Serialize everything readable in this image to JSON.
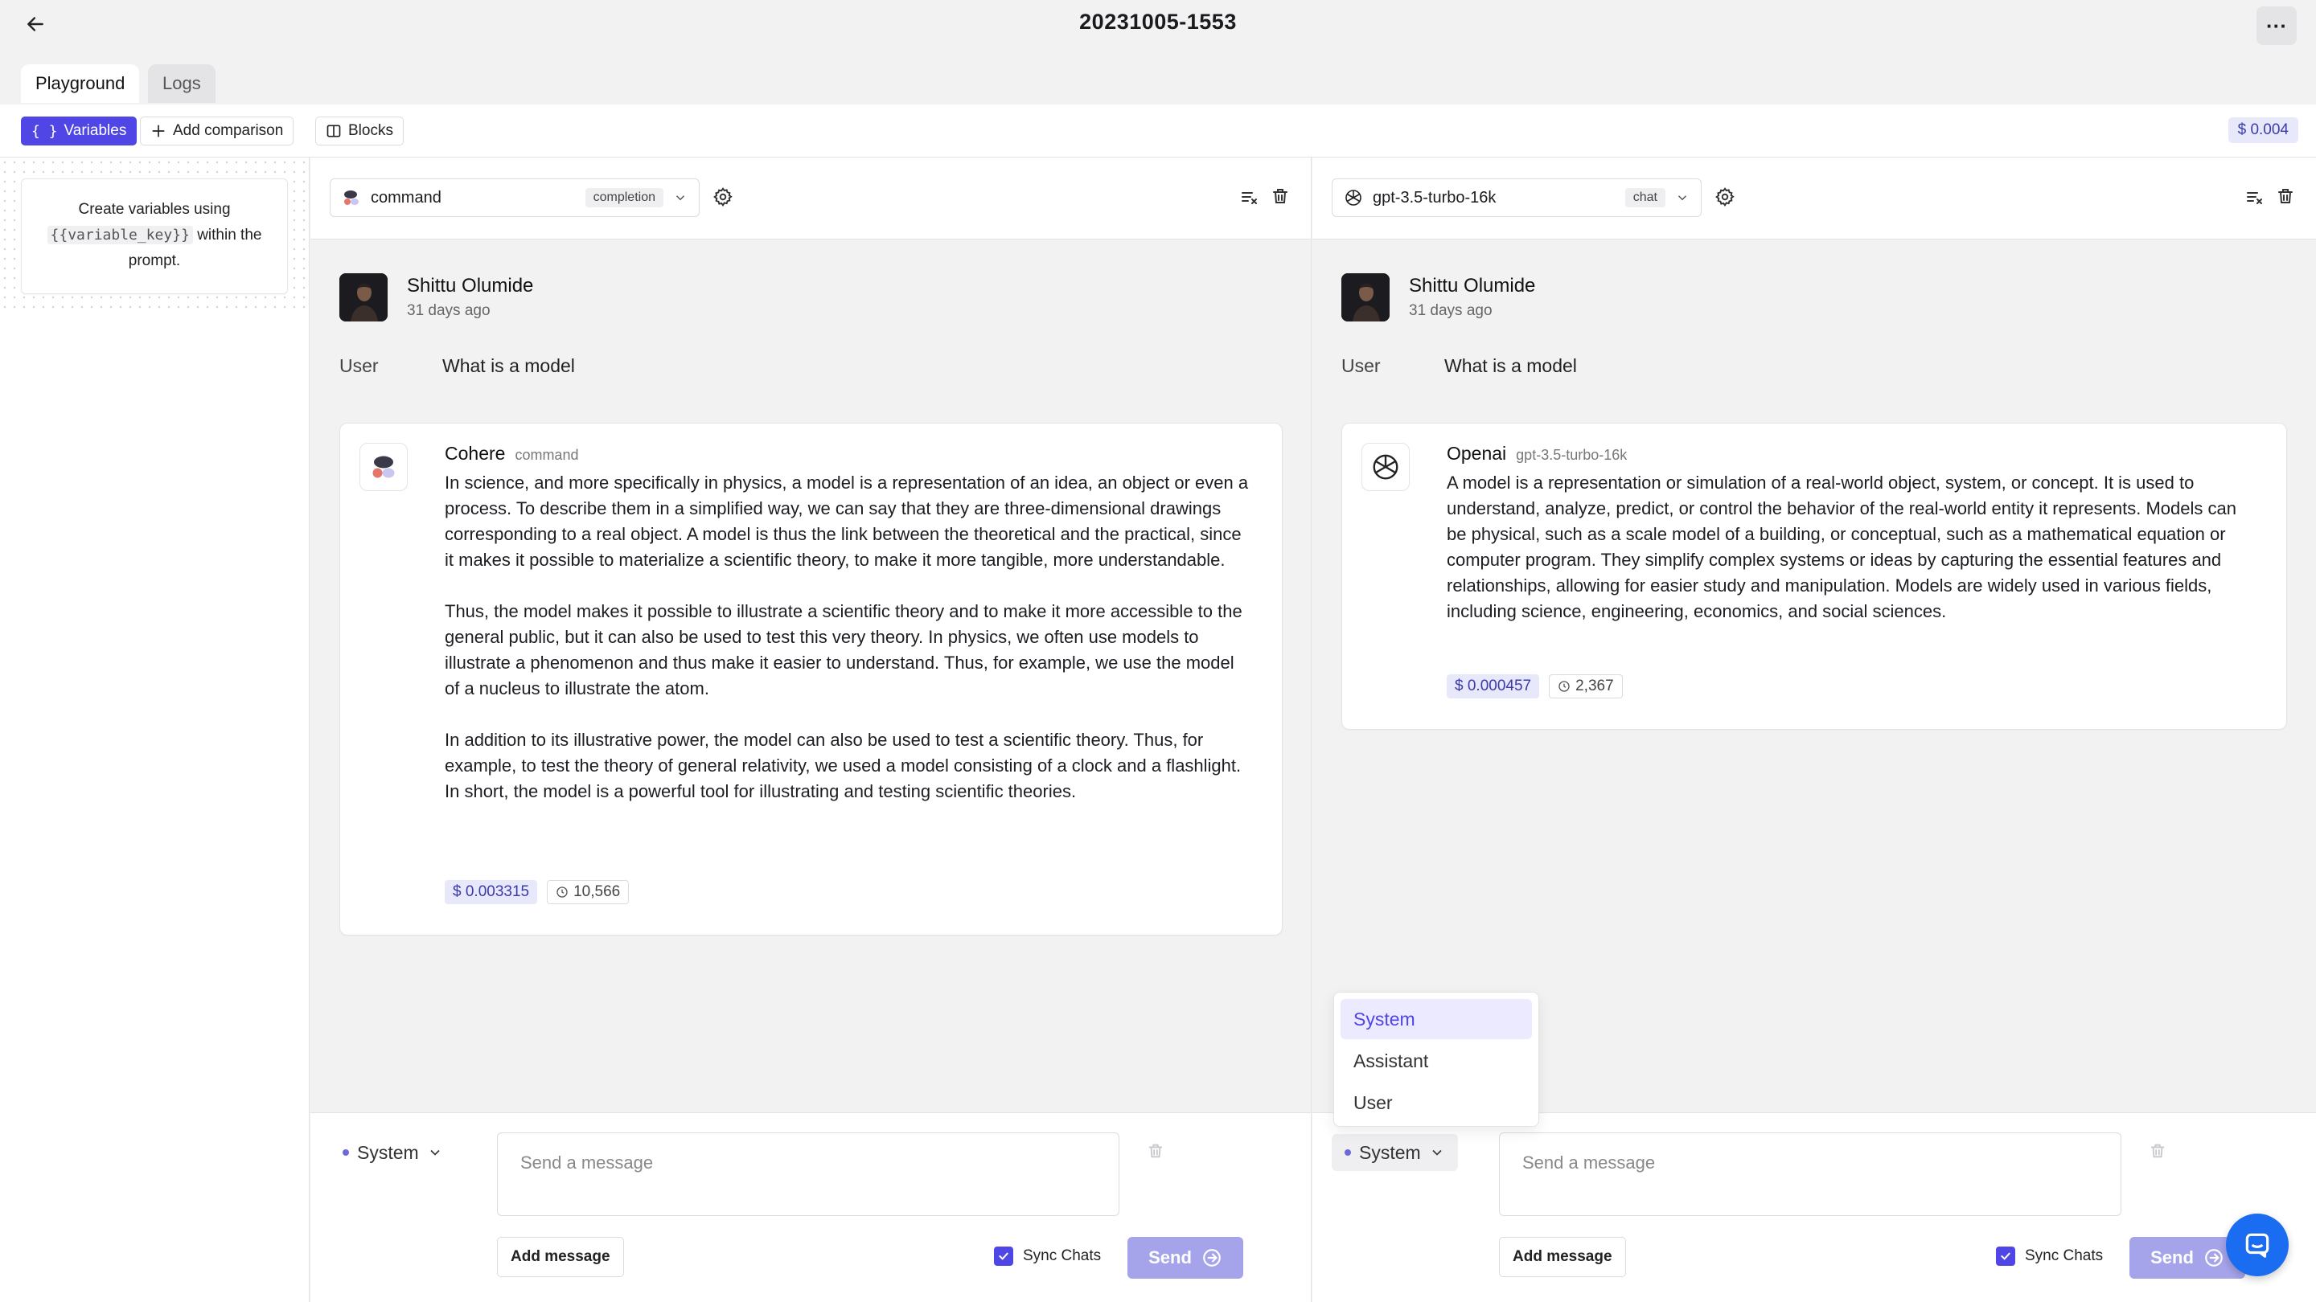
{
  "header": {
    "title": "20231005-1553",
    "more_label": "···"
  },
  "tabs": [
    {
      "label": "Playground",
      "active": true
    },
    {
      "label": "Logs",
      "active": false
    }
  ],
  "toolbar": {
    "variables_label": "Variables",
    "add_comparison_label": "Add comparison",
    "blocks_label": "Blocks",
    "total_cost": "$ 0.004"
  },
  "variables_panel": {
    "line1": "Create variables using",
    "key": "{{variable_key}}",
    "line2": "within the",
    "line3": "prompt."
  },
  "panes": [
    {
      "model": "command",
      "model_kind": "completion",
      "user": {
        "name": "Shittu Olumide",
        "time": "31 days ago",
        "role": "User",
        "message": "What is a model"
      },
      "response": {
        "provider": "Cohere",
        "model": "command",
        "paragraphs": [
          "In science, and more specifically in physics, a model is a representation of an idea, an object or even a process. To describe them in a simplified way, we can say that they are three-dimensional drawings corresponding to a real object. A model is thus the link between the theoretical and the practical, since it makes it possible to materialize a scientific theory, to make it more tangible, more understandable.",
          "Thus, the model makes it possible to illustrate a scientific theory and to make it more accessible to the general public, but it can also be used to test this very theory. In physics, we often use models to illustrate a phenomenon and thus make it easier to understand. Thus, for example, we use the model of a nucleus to illustrate the atom.",
          "In addition to its illustrative power, the model can also be used to test a scientific theory. Thus, for example, to test the theory of general relativity, we used a model consisting of a clock and a flashlight. In short, the model is a powerful tool for illustrating and testing scientific theories."
        ],
        "cost": "$ 0.003315",
        "tokens": "10,566"
      },
      "composer": {
        "role": "System",
        "placeholder": "Send a message",
        "add_message": "Add message",
        "sync_label": "Sync Chats",
        "send_label": "Send"
      }
    },
    {
      "model": "gpt-3.5-turbo-16k",
      "model_kind": "chat",
      "user": {
        "name": "Shittu Olumide",
        "time": "31 days ago",
        "role": "User",
        "message": "What is a model"
      },
      "response": {
        "provider": "Openai",
        "model": "gpt-3.5-turbo-16k",
        "paragraphs": [
          "A model is a representation or simulation of a real-world object, system, or concept. It is used to understand, analyze, predict, or control the behavior of the real-world entity it represents. Models can be physical, such as a scale model of a building, or conceptual, such as a mathematical equation or computer program. They simplify complex systems or ideas by capturing the essential features and relationships, allowing for easier study and manipulation. Models are widely used in various fields, including science, engineering, economics, and social sciences."
        ],
        "cost": "$ 0.000457",
        "tokens": "2,367"
      },
      "composer": {
        "role": "System",
        "placeholder": "Send a message",
        "add_message": "Add message",
        "sync_label": "Sync Chats",
        "send_label": "Send"
      }
    }
  ],
  "role_menu": {
    "options": [
      "System",
      "Assistant",
      "User"
    ],
    "selected": "System"
  },
  "icons": {
    "back": "arrow-left-icon",
    "settings": "gear-icon",
    "clear": "clear-list-icon",
    "delete": "trash-icon",
    "clock": "clock-icon",
    "send": "arrow-circle-right-icon",
    "chat": "chat-bubble-icon"
  },
  "colors": {
    "accent": "#4f46e5",
    "accent_light": "#a5a3ea",
    "cost_bg": "#e7e9fb",
    "launcher": "#1a6cf0"
  }
}
